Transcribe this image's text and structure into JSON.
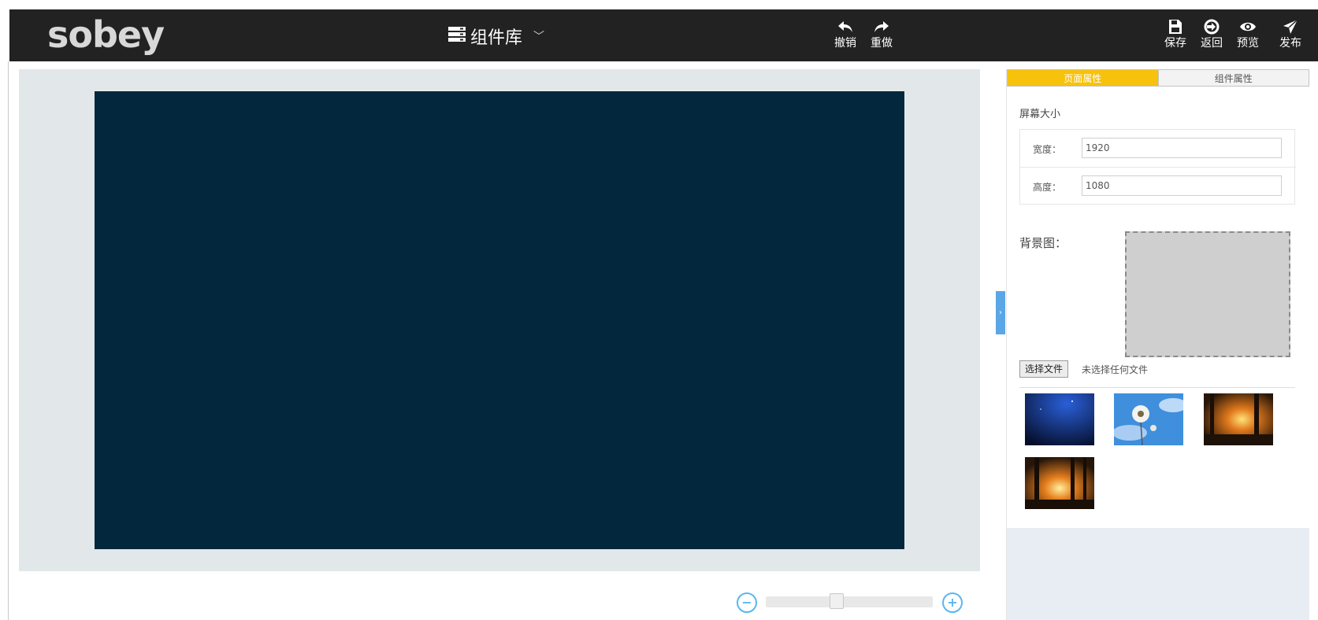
{
  "header": {
    "logo": "sobey",
    "library_label": "组件库",
    "tools": {
      "undo": "撤销",
      "redo": "重做",
      "save": "保存",
      "back": "返回",
      "preview": "预览",
      "publish": "发布"
    }
  },
  "panel": {
    "tabs": [
      "页面属性",
      "组件属性"
    ],
    "active_tab": "页面属性",
    "screen_size": {
      "title": "屏幕大小",
      "width_label": "宽度：",
      "width_value": "1920",
      "height_label": "高度：",
      "height_value": "1080"
    },
    "background": {
      "label": "背景图：",
      "file_button": "选择文件",
      "file_status": "未选择任何文件"
    },
    "thumbnails": [
      "night-sky-thumbnail",
      "dandelion-thumbnail",
      "sunset-trees-thumbnail",
      "sunset-forest-thumbnail"
    ]
  },
  "canvas": {
    "background_color": "#03273d",
    "workspace_color": "#e2e8ea"
  },
  "zoom": {
    "level": 0.42
  },
  "colors": {
    "header_bg": "#222222",
    "accent_tab": "#f7c20c",
    "zoom_accent": "#57b8f0",
    "collapse_handle": "#5aa6e6"
  }
}
